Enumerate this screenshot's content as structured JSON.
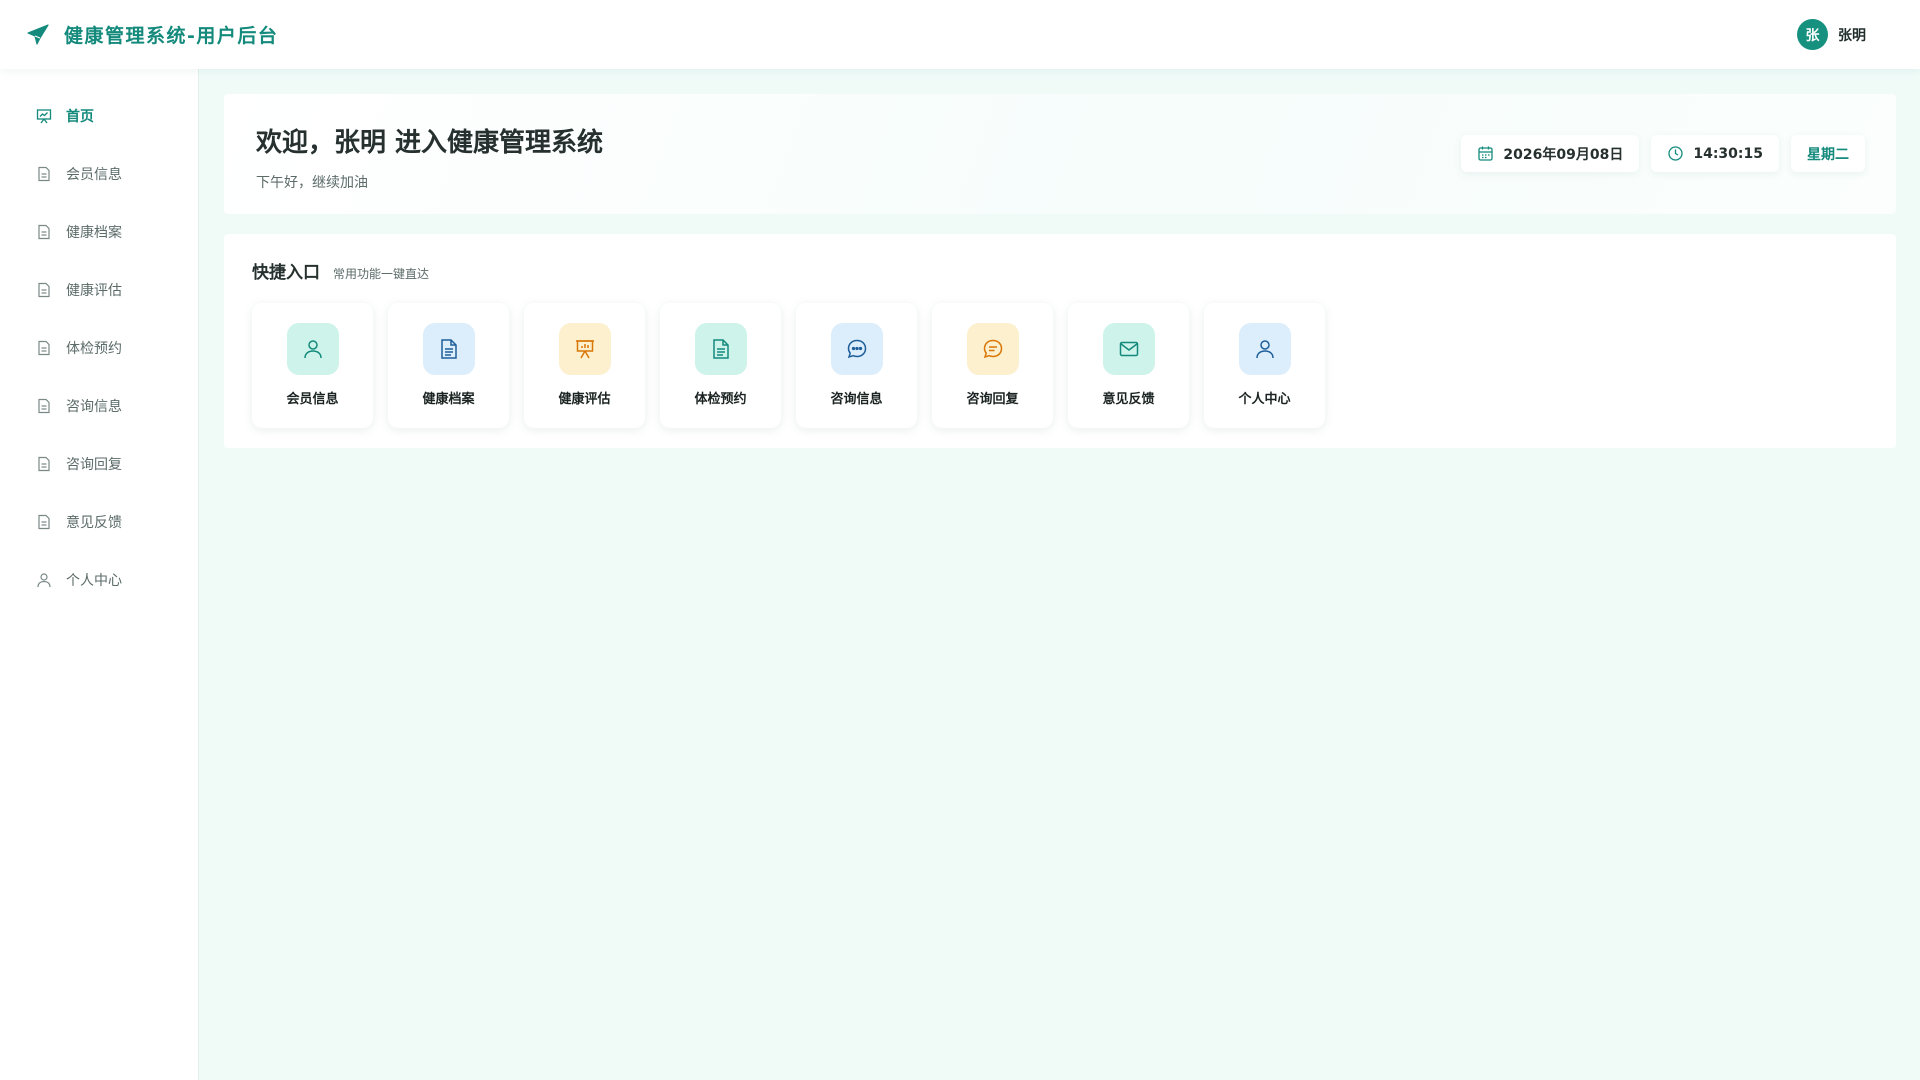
{
  "header": {
    "title": "健康管理系统-用户后台",
    "brand_icon": "paper-plane-icon",
    "avatar_text": "张",
    "username": "张明",
    "accent": "#148a7c"
  },
  "sidebar": {
    "items": [
      {
        "label": "首页",
        "icon": "presentation-chart-icon",
        "active": true
      },
      {
        "label": "会员信息",
        "icon": "document-icon"
      },
      {
        "label": "健康档案",
        "icon": "document-icon"
      },
      {
        "label": "健康评估",
        "icon": "document-icon"
      },
      {
        "label": "体检预约",
        "icon": "document-icon"
      },
      {
        "label": "咨询信息",
        "icon": "document-icon"
      },
      {
        "label": "咨询回复",
        "icon": "document-icon"
      },
      {
        "label": "意见反馈",
        "icon": "document-icon"
      },
      {
        "label": "个人中心",
        "icon": "user-icon"
      }
    ]
  },
  "welcome": {
    "title": "欢迎，张明 进入健康管理系统",
    "subtitle": "下午好，继续加油",
    "date": "2026年09月08日",
    "time": "14:30:15",
    "weekday": "星期二"
  },
  "quick": {
    "title": "快捷入口",
    "subtitle": "常用功能一键直达",
    "tiles": [
      {
        "label": "会员信息",
        "icon": "user-icon",
        "color": "#cdf3ea"
      },
      {
        "label": "健康档案",
        "icon": "document-icon",
        "color": "#dcedfb"
      },
      {
        "label": "健康评估",
        "icon": "presentation-chart-icon",
        "color": "#fdf0cf"
      },
      {
        "label": "体检预约",
        "icon": "document-icon",
        "color": "#cdf3ea"
      },
      {
        "label": "咨询信息",
        "icon": "chat-bubble-icon",
        "color": "#dcedfb"
      },
      {
        "label": "咨询回复",
        "icon": "chat-bubble-lines-icon",
        "color": "#fdf0cf"
      },
      {
        "label": "意见反馈",
        "icon": "mail-icon",
        "color": "#cdf3ea"
      },
      {
        "label": "个人中心",
        "icon": "user-icon",
        "color": "#dcedfb"
      }
    ]
  }
}
